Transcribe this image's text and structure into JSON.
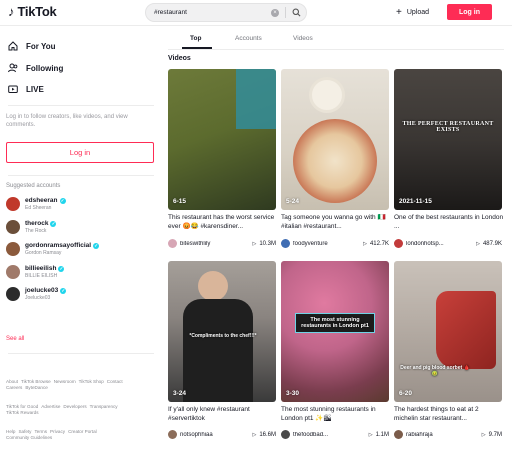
{
  "header": {
    "logo_text": "TikTok",
    "search_value": "#restaurant",
    "upload_label": "Upload",
    "login_label": "Log in"
  },
  "sidebar": {
    "nav": [
      {
        "label": "For You",
        "icon": "home-icon"
      },
      {
        "label": "Following",
        "icon": "following-icon"
      },
      {
        "label": "LIVE",
        "icon": "live-icon"
      }
    ],
    "login_message": "Log in to follow creators, like videos, and view comments.",
    "login_button": "Log in",
    "suggested_title": "Suggested accounts",
    "accounts": [
      {
        "handle": "edsheeran",
        "name": "Ed Sheeran",
        "color": "#c0392b"
      },
      {
        "handle": "therock",
        "name": "The Rock",
        "color": "#6b4f3a"
      },
      {
        "handle": "gordonramsayofficial",
        "name": "Gordon Ramsay",
        "color": "#8b5a3c"
      },
      {
        "handle": "billieeilish",
        "name": "BILLIE EILISH",
        "color": "#a07a6a"
      },
      {
        "handle": "joelucke03",
        "name": "Joelucke03",
        "color": "#2c2c2c"
      }
    ],
    "see_all": "See all",
    "footer": [
      [
        "About",
        "TikTok Browse",
        "Newsroom",
        "TikTok Shop",
        "Contact",
        "Careers",
        "ByteDance"
      ],
      [
        "TikTok for Good",
        "Advertise",
        "Developers",
        "Transparency",
        "TikTok Rewards"
      ],
      [
        "Help",
        "Safety",
        "Terms",
        "Privacy",
        "Creator Portal",
        "Community Guidelines"
      ]
    ]
  },
  "tabs": [
    "Top",
    "Accounts",
    "Videos"
  ],
  "section_title": "Videos",
  "videos": [
    {
      "date": "6-15",
      "desc": "This restaurant has the worst service ever 😡😂 #karensdiner...",
      "user": "biteswithlily",
      "views": "10.3M",
      "bg": "#5c6b2e",
      "bg2": "#2f3a20",
      "overlay": "",
      "avatar": "#d7a6b5"
    },
    {
      "date": "5-24",
      "desc": "Tag someone you wanna go with 🇮🇹 #italian #restaurant...",
      "user": "foodyventure",
      "views": "412.7K",
      "bg": "#d8d1c4",
      "bg2": "#b26044",
      "overlay": "",
      "avatar": "#3f6db3"
    },
    {
      "date": "2021-11-15",
      "desc": "One of the best restaurants in London ...",
      "user": "londonhotsp...",
      "views": "487.9K",
      "bg": "#3a3633",
      "bg2": "#1b1918",
      "overlay": "THE PERFECT RESTAURANT EXISTS",
      "avatar": "#c23b3b"
    },
    {
      "date": "3-24",
      "desc": "If y'all only knew #restaurant #servertiktok",
      "user": "notsophhiaa",
      "views": "16.6M",
      "bg": "#8a8480",
      "bg2": "#2a2a2a",
      "overlay": "*Compliments to the chef!!!*",
      "avatar": "#8c6d5a"
    },
    {
      "date": "3-30",
      "desc": "The most stunning restaurants in London pt1 ✨🏙",
      "user": "thefoodbad...",
      "views": "1.1M",
      "bg": "#c0658a",
      "bg2": "#5a3a2e",
      "overlay": "The most stunning restaurants in London pt1",
      "avatar": "#4a4a4a"
    },
    {
      "date": "6-20",
      "desc": "The hardest things to eat at 2 michelin star restaurant...",
      "user": "rabiahraja",
      "views": "9.7M",
      "bg": "#b5aca4",
      "bg2": "#a8312c",
      "overlay": "Deer and pig blood sorbet 🩸🤢",
      "avatar": "#7b5c4a"
    }
  ]
}
